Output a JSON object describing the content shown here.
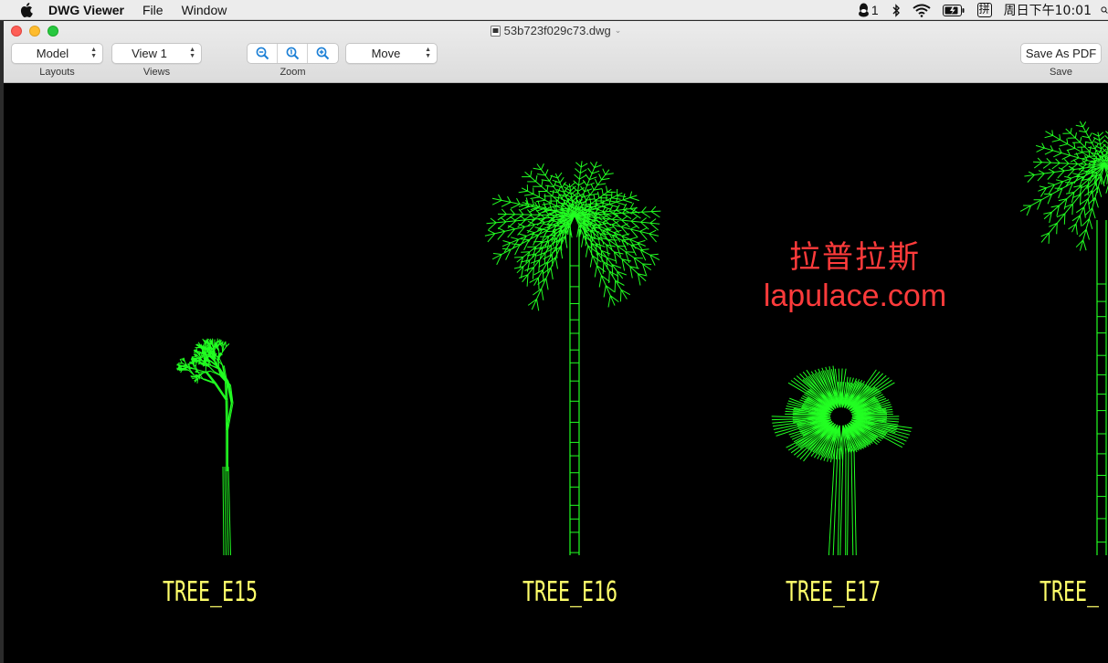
{
  "menubar": {
    "app_name": "DWG Viewer",
    "menus": [
      "File",
      "Window"
    ],
    "qq_count": "1",
    "ime": "拼",
    "clock": "周日下午10:01"
  },
  "window": {
    "title": "53b723f029c73.dwg",
    "toolbar": {
      "layouts_value": "Model",
      "layouts_caption": "Layouts",
      "views_value": "View 1",
      "views_caption": "Views",
      "zoom_caption": "Zoom",
      "tool_value": "Move",
      "save_label": "Save As PDF",
      "save_caption": "Save"
    }
  },
  "drawing": {
    "labels": [
      "TREE_E15",
      "TREE_E16",
      "TREE_E17",
      "TREE_"
    ],
    "watermark_cn": "拉普拉斯",
    "watermark_url": "lapulace.com",
    "line_color": "#22ff22",
    "label_color": "#ffff6a",
    "watermark_color": "#ff3b3b"
  }
}
